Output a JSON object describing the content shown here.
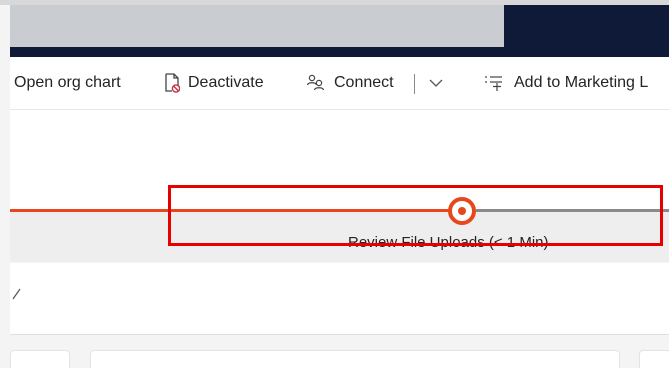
{
  "toolbar": {
    "open_org_chart": "Open org chart",
    "deactivate": "Deactivate",
    "connect": "Connect",
    "add_to_marketing": "Add to Marketing L"
  },
  "business_process": {
    "active_stage_label": "Review File Uploads  (< 1 Min)"
  },
  "colors": {
    "top_band": "#0e1a38",
    "search_box": "#c9ccd1",
    "process_active": "#e8461b",
    "process_inactive": "#8a8a8a",
    "highlight": "#e60000"
  },
  "icons": {
    "deactivate": "document-blocked-icon",
    "connect": "people-connect-icon",
    "connect_more": "chevron-down-icon",
    "add_to_marketing": "add-to-list-icon",
    "stage": "active-stage-icon",
    "field": "checkmark-icon"
  }
}
